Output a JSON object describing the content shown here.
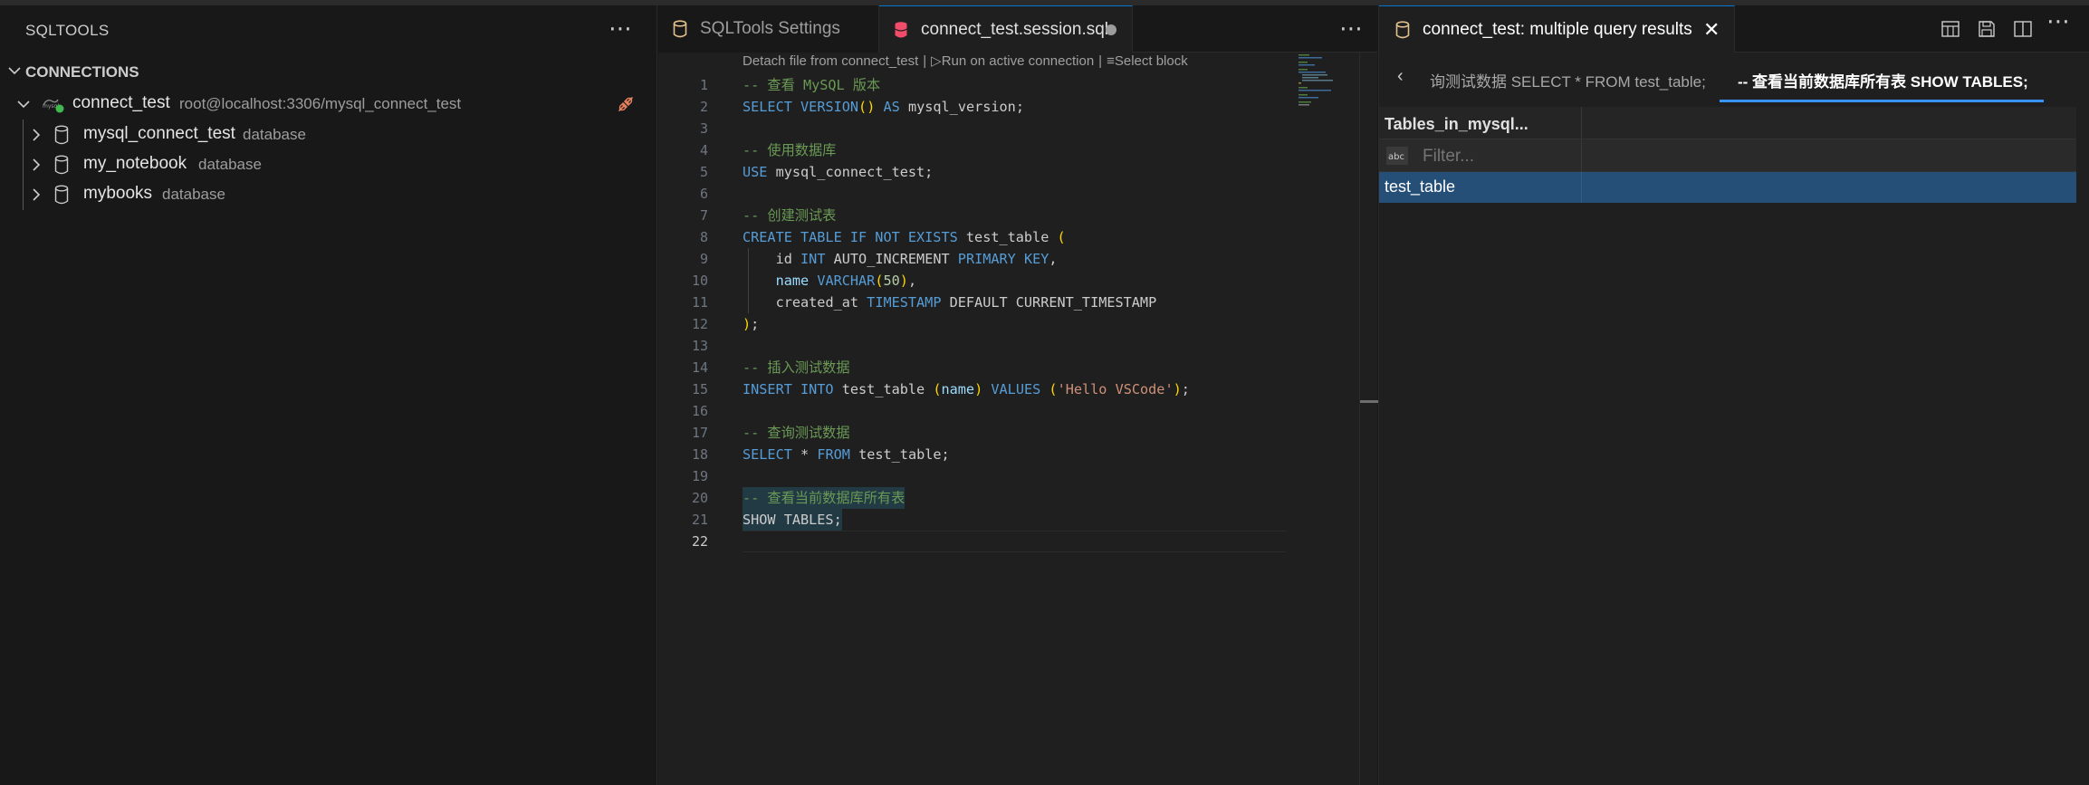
{
  "sidebar": {
    "title": "SQLTOOLS",
    "section_title": "CONNECTIONS",
    "connection": {
      "name": "connect_test",
      "description": "root@localhost:3306/mysql_connect_test"
    },
    "databases": [
      {
        "name": "mysql_connect_test",
        "description": "database"
      },
      {
        "name": "my_notebook",
        "description": "database"
      },
      {
        "name": "mybooks",
        "description": "database"
      }
    ]
  },
  "editor": {
    "tabs": [
      {
        "label": "SQLTools Settings"
      },
      {
        "label": "connect_test.session.sql"
      }
    ],
    "codelens": {
      "detach": "Detach file from connect_test",
      "run": "Run on active connection",
      "select": "Select block",
      "separator": "|"
    },
    "line_numbers": [
      "1",
      "2",
      "3",
      "4",
      "5",
      "6",
      "7",
      "8",
      "9",
      "10",
      "11",
      "12",
      "13",
      "14",
      "15",
      "16",
      "17",
      "18",
      "19",
      "20",
      "21",
      "22"
    ],
    "code": {
      "l1": "-- 查看 MySQL 版本",
      "l2_kw1": "SELECT",
      "l2_fn": "VERSION",
      "l2_br": "()",
      "l2_kw2": "AS",
      "l2_id": "mysql_version;",
      "l4": "-- 使用数据库",
      "l5_kw": "USE",
      "l5_id": "mysql_connect_test;",
      "l7": "-- 创建测试表",
      "l8_kw": "CREATE TABLE IF NOT EXISTS",
      "l8_id": "test_table",
      "l8_br": "(",
      "l9_id1": "id",
      "l9_kw1": "INT",
      "l9_id2": "AUTO_INCREMENT",
      "l9_kw2": "PRIMARY KEY",
      "l9_p": ",",
      "l10_col": "name",
      "l10_kw": "VARCHAR",
      "l10_br1": "(",
      "l10_num": "50",
      "l10_br2": ")",
      "l10_p": ",",
      "l11_id1": "created_at",
      "l11_kw": "TIMESTAMP",
      "l11_id2": "DEFAULT CURRENT_TIMESTAMP",
      "l12_br": ")",
      "l12_p": ";",
      "l14": "-- 插入测试数据",
      "l15_kw1": "INSERT INTO",
      "l15_id": "test_table",
      "l15_br1": "(",
      "l15_col": "name",
      "l15_br2": ")",
      "l15_kw2": "VALUES",
      "l15_br3": "(",
      "l15_str": "'Hello VSCode'",
      "l15_br4": ")",
      "l15_p": ";",
      "l17": "-- 查询测试数据",
      "l18_kw1": "SELECT",
      "l18_op": "*",
      "l18_kw2": "FROM",
      "l18_id": "test_table;",
      "l20": "-- 查看当前数据库所有表",
      "l21": "SHOW TABLES;"
    }
  },
  "results": {
    "tab_label": "connect_test: multiple query results",
    "subtabs": [
      {
        "label": "询测试数据 SELECT * FROM test_table;"
      },
      {
        "label": "-- 查看当前数据库所有表 SHOW TABLES;"
      }
    ],
    "grid": {
      "columns": [
        "Tables_in_mysql..."
      ],
      "filter_placeholder": "Filter...",
      "filter_icon_text": "abc",
      "rows": [
        [
          "test_table"
        ]
      ]
    }
  },
  "colors": {
    "accent": "#0078d4",
    "selected_row": "#264f78",
    "connected": "#3fb950",
    "sql_file_icon": "#f14c6a",
    "settings_icon": "#e2c08d"
  }
}
